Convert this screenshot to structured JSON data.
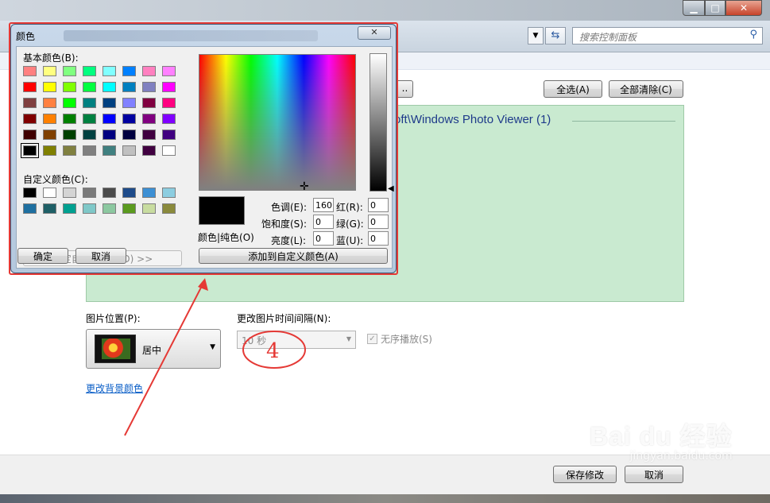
{
  "search": {
    "placeholder": "搜索控制面板"
  },
  "buttons": {
    "select_all": "全选(A)",
    "clear_all": "全部清除(C)",
    "partial": "..",
    "save": "保存修改",
    "cancel": "取消"
  },
  "picture_folder": {
    "label": "oft\\Windows Photo Viewer (1)"
  },
  "position": {
    "label": "图片位置(P):",
    "value": "居中"
  },
  "interval": {
    "label": "更改图片时间间隔(N):",
    "value": "10 秒"
  },
  "shuffle": {
    "label": "无序播放(S)",
    "checked": true
  },
  "change_bg_link": "更改背景颜色",
  "color_dialog": {
    "title": "颜色",
    "basic_label": "基本颜色(B):",
    "custom_label": "自定义颜色(C):",
    "define_button": "规定自定义颜色(D) >>",
    "ok": "确定",
    "cancel": "取消",
    "close": "✕",
    "preview_label": "颜色|纯色(O)",
    "add_button": "添加到自定义颜色(A)",
    "fields": [
      {
        "label": "色调(E):",
        "value": "160"
      },
      {
        "label": "饱和度(S):",
        "value": "0"
      },
      {
        "label": "亮度(L):",
        "value": "0"
      },
      {
        "label": "红(R):",
        "value": "0"
      },
      {
        "label": "绿(G):",
        "value": "0"
      },
      {
        "label": "蓝(U):",
        "value": "0"
      }
    ],
    "basic_colors": [
      "#ff8080",
      "#ffff80",
      "#80ff80",
      "#00ff80",
      "#80ffff",
      "#0080ff",
      "#ff80c0",
      "#ff80ff",
      "#ff0000",
      "#ffff00",
      "#80ff00",
      "#00ff40",
      "#00ffff",
      "#0080c0",
      "#8080c0",
      "#ff00ff",
      "#804040",
      "#ff8040",
      "#00ff00",
      "#008080",
      "#004080",
      "#8080ff",
      "#800040",
      "#ff0080",
      "#800000",
      "#ff8000",
      "#008000",
      "#008040",
      "#0000ff",
      "#0000a0",
      "#800080",
      "#8000ff",
      "#400000",
      "#804000",
      "#004000",
      "#004040",
      "#000080",
      "#000040",
      "#400040",
      "#400080",
      "#000000",
      "#808000",
      "#808040",
      "#808080",
      "#408080",
      "#c0c0c0",
      "#400040",
      "#ffffff"
    ],
    "custom_colors": [
      "#000000",
      "#ffffff",
      "#d4d4d4",
      "#7a7a7a",
      "#4b4b4b",
      "#1e4b8a",
      "#3c8fd4",
      "#8ccde0",
      "#1e6fa0",
      "#1e5f66",
      "#00a090",
      "#7fc8c8",
      "#8cc8a0",
      "#5a9a1e",
      "#c8dca0",
      "#8a8a3c"
    ]
  },
  "annotation": {
    "step": "4"
  },
  "watermark": {
    "brand": "Bai du 经验",
    "url": "jingyan.baidu.com"
  }
}
